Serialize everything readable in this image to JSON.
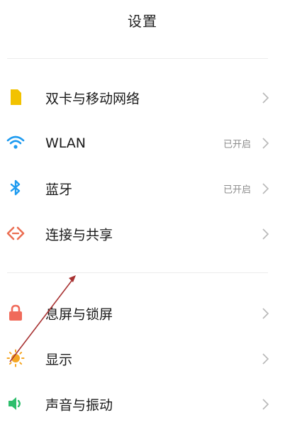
{
  "header": {
    "title": "设置"
  },
  "items": [
    {
      "label": "双卡与移动网络",
      "status": "",
      "icon": "sim-card-icon",
      "color": "#F2C200"
    },
    {
      "label": "WLAN",
      "status": "已开启",
      "icon": "wifi-icon",
      "color": "#1E9BF0"
    },
    {
      "label": "蓝牙",
      "status": "已开启",
      "icon": "bluetooth-icon",
      "color": "#1E9BF0"
    },
    {
      "label": "连接与共享",
      "status": "",
      "icon": "connection-share-icon",
      "color": "#EB6E52"
    },
    {
      "label": "息屏与锁屏",
      "status": "",
      "icon": "lock-icon",
      "color": "#F06A5A"
    },
    {
      "label": "显示",
      "status": "",
      "icon": "sun-icon",
      "color": "#F5A623"
    },
    {
      "label": "声音与振动",
      "status": "",
      "icon": "speaker-icon",
      "color": "#2DBE6C"
    }
  ]
}
